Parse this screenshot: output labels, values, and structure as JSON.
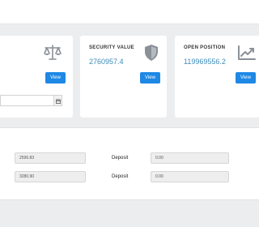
{
  "cards": [
    {
      "label": "",
      "value": "",
      "button": "View",
      "icon": "scale-icon"
    },
    {
      "label": "SECURITY VALUE",
      "value": "2760957.4",
      "button": "View",
      "icon": "shield-icon"
    },
    {
      "label": "OPEN POSITION",
      "value": "119969556.2",
      "button": "View",
      "icon": "chart-line-icon"
    }
  ],
  "date_field": {
    "value": ""
  },
  "rows": [
    {
      "amount": "2596.83",
      "label": "Deposit",
      "deposit": "0.00"
    },
    {
      "amount": "3280.90",
      "label": "Deposit",
      "deposit": "0.00"
    }
  ],
  "colors": {
    "accent": "#3c8dbc",
    "button": "#1e88e5",
    "background": "#ecedef"
  }
}
